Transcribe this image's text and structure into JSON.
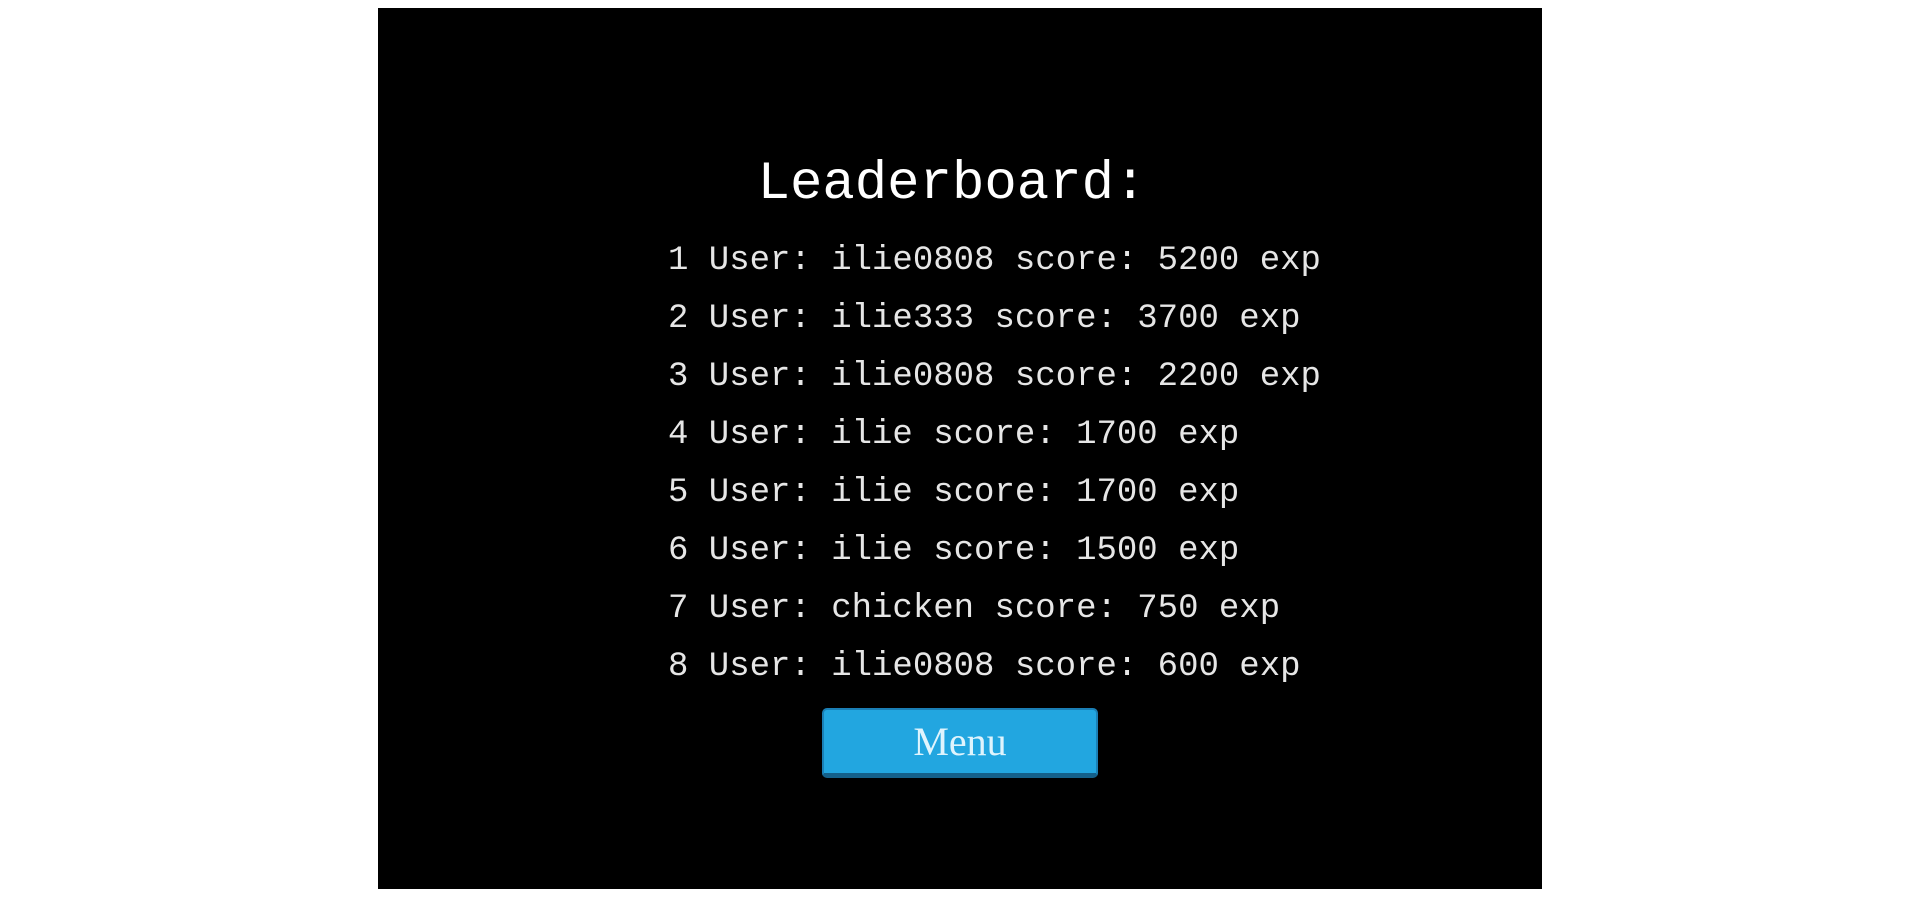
{
  "leaderboard": {
    "title": "Leaderboard:",
    "entries": [
      {
        "text": "1 User: ilie0808 score: 5200 exp"
      },
      {
        "text": "2 User: ilie333 score: 3700 exp"
      },
      {
        "text": "3 User: ilie0808 score: 2200 exp"
      },
      {
        "text": "4 User: ilie score: 1700 exp"
      },
      {
        "text": "5 User: ilie score: 1700 exp"
      },
      {
        "text": "6 User: ilie score: 1500 exp"
      },
      {
        "text": "7 User: chicken score: 750 exp"
      },
      {
        "text": "8 User: ilie0808 score: 600 exp"
      }
    ],
    "menu_button_label": "Menu"
  },
  "colors": {
    "background": "#000000",
    "text": "#e6e6e6",
    "button": "#22a6e0"
  }
}
